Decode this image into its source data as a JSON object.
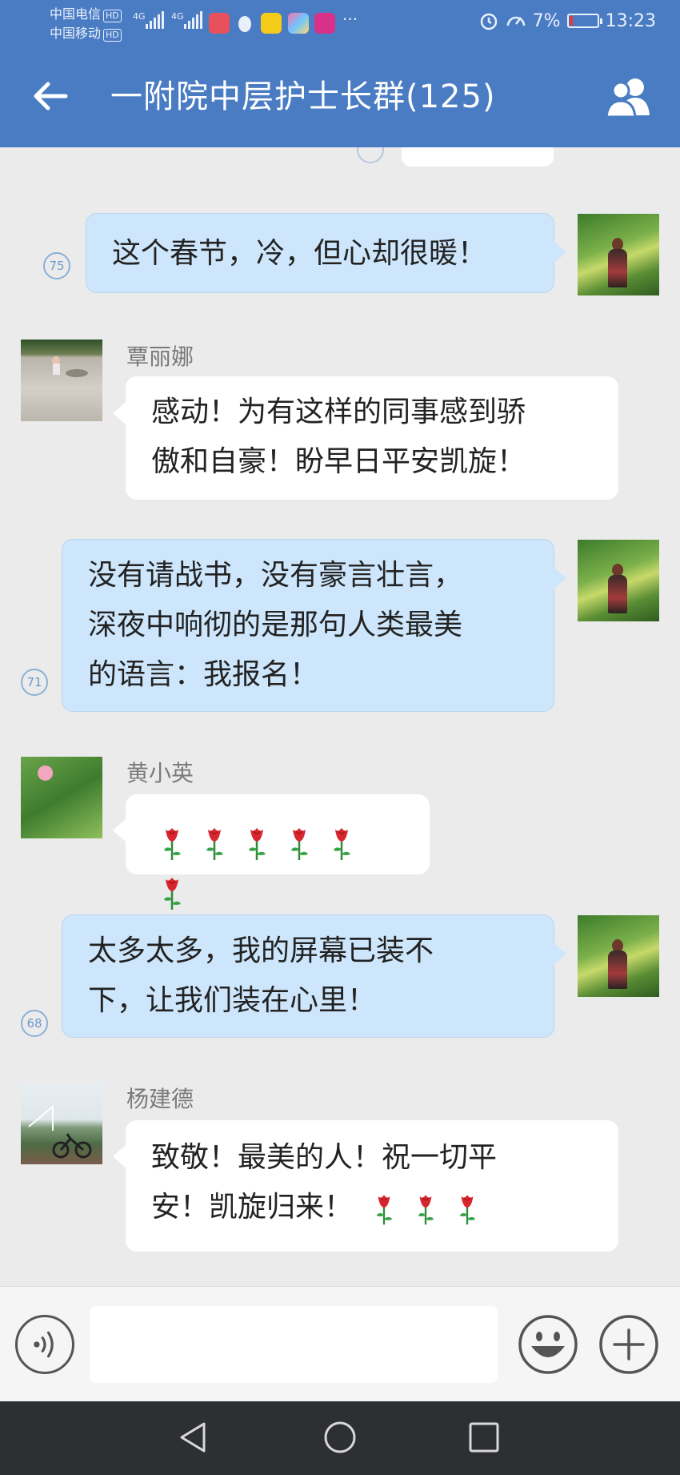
{
  "status_bar": {
    "carrier1": "中国电信",
    "carrier2": "中国移动",
    "hd": "HD",
    "network": "4G",
    "more": "···",
    "battery_percent": "7%",
    "time": "13:23",
    "battery_level": 0.07,
    "colors": {
      "battery_low": "#e23b3b"
    }
  },
  "header": {
    "title": "一附院中层护士长群(125)",
    "back_icon": "arrow-left-icon",
    "members_icon": "group-members-icon"
  },
  "messages": [
    {
      "side": "self",
      "unread": "75",
      "text": "这个春节，冷，但心却很暖！"
    },
    {
      "side": "other",
      "sender": "覃丽娜",
      "lines": [
        "感动！为有这样的同事感到骄",
        "傲和自豪！盼早日平安凯旋！"
      ]
    },
    {
      "side": "self",
      "unread": "71",
      "lines": [
        "没有请战书，没有豪言壮言，",
        "深夜中响彻的是那句人类最美",
        "的语言：我报名！"
      ]
    },
    {
      "side": "other",
      "sender": "黄小英",
      "emoji": "rose",
      "emoji_count": 6
    },
    {
      "side": "self",
      "unread": "68",
      "lines": [
        "太多太多，我的屏幕已装不",
        "下，让我们装在心里！"
      ]
    },
    {
      "side": "other",
      "sender": "杨建德",
      "lines": [
        "致敬！最美的人！祝一切平",
        "安！凯旋归来！"
      ],
      "trailing_emoji": "rose",
      "trailing_emoji_count": 3
    }
  ],
  "input_bar": {
    "placeholder": "",
    "voice_icon": "voice-icon",
    "emoji_icon": "smiley-icon",
    "plus_icon": "plus-icon"
  },
  "nav_bar": {
    "back_icon": "triangle-back-icon",
    "home_icon": "circle-home-icon",
    "recents_icon": "square-recents-icon"
  },
  "colors": {
    "header_bg": "#4a7cc4",
    "self_bubble": "#cde6fb",
    "other_bubble": "#ffffff",
    "chat_bg": "#ebebeb"
  }
}
